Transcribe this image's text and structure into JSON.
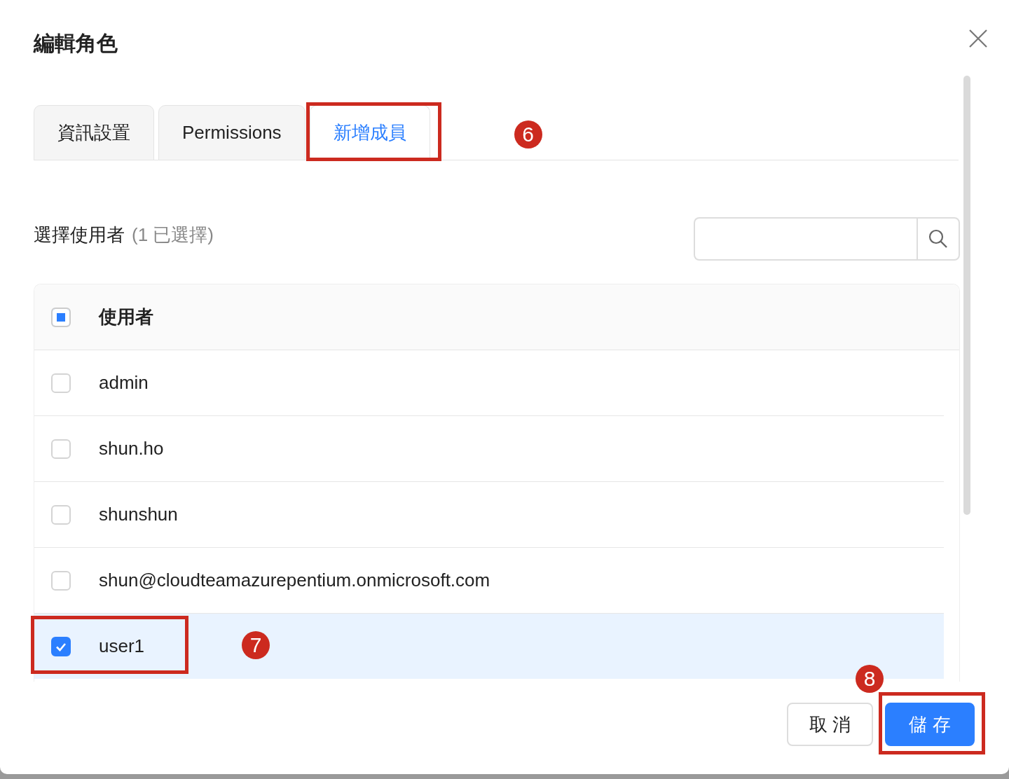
{
  "dialog": {
    "title": "編輯角色"
  },
  "tabs": [
    {
      "label": "資訊設置",
      "selected": false
    },
    {
      "label": "Permissions",
      "selected": false
    },
    {
      "label": "新增成員",
      "selected": true,
      "callout": "6"
    }
  ],
  "picker": {
    "label": "選擇使用者",
    "count": "(1 已選擇)"
  },
  "table": {
    "header": {
      "label": "使用者",
      "indeterminate": true
    },
    "rows": [
      {
        "name": "admin",
        "checked": false,
        "selected": false
      },
      {
        "name": "shun.ho",
        "checked": false,
        "selected": false
      },
      {
        "name": "shunshun",
        "checked": false,
        "selected": false
      },
      {
        "name": "shun@cloudteamazurepentium.onmicrosoft.com",
        "checked": false,
        "selected": false
      },
      {
        "name": "user1",
        "checked": true,
        "selected": true,
        "callout": "7"
      }
    ]
  },
  "buttons": [
    {
      "label": "取 消",
      "kind": "default"
    },
    {
      "label": "儲 存",
      "kind": "primary",
      "callout": "8"
    }
  ]
}
